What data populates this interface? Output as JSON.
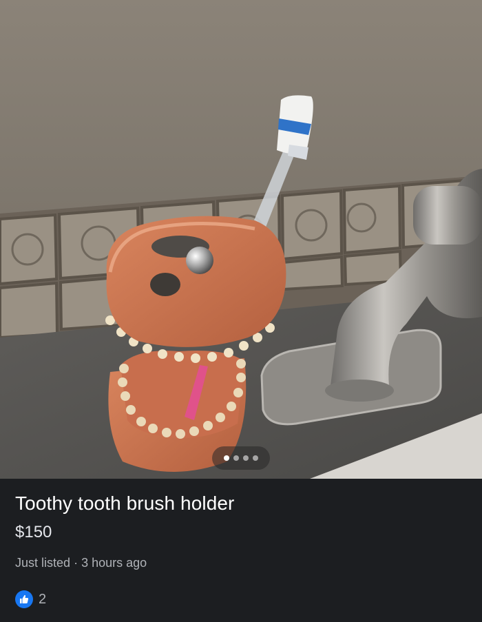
{
  "listing": {
    "title": "Toothy tooth brush holder",
    "price": "$150",
    "listed_text": "Just listed",
    "separator": "·",
    "time_ago": "3 hours ago"
  },
  "photo": {
    "carousel_total": 4,
    "carousel_active_index": 0
  },
  "reactions": {
    "like_icon": "thumbs-up-icon",
    "like_count": "2"
  },
  "colors": {
    "background": "#1c1e21",
    "like_blue": "#1877f2",
    "title_text": "#ffffff",
    "secondary_text": "#b0b3b8"
  }
}
